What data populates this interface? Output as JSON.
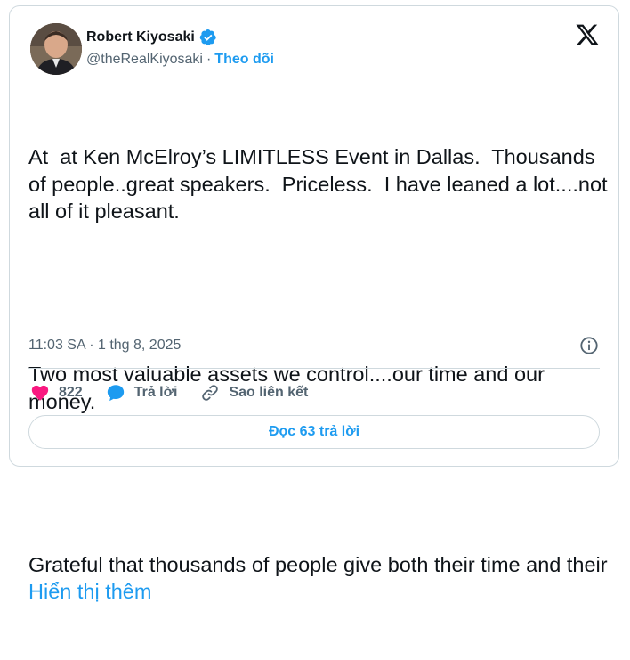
{
  "author": {
    "name": "Robert Kiyosaki",
    "handle": "@theRealKiyosaki",
    "separator": "·",
    "follow_label": "Theo dõi"
  },
  "tweet": {
    "paragraphs": [
      "At  at Ken McElroy’s LIMITLESS Event in Dallas.  Thousands of people..great speakers.  Priceless.  I have leaned a lot....not all of it pleasant.",
      "Two most valuable assets we control....our time and our money.",
      "Grateful that thousands of people give both their time and their "
    ],
    "show_more_label": "Hiển thị thêm",
    "timestamp": "11:03 SA · 1 thg 8, 2025"
  },
  "actions": {
    "like_count": "822",
    "reply_label": "Trả lời",
    "copy_link_label": "Sao liên kết"
  },
  "replies_button_label": "Đọc 63 trả lời",
  "colors": {
    "accent": "#1d9bf0",
    "like": "#f91880",
    "text": "#0f1419",
    "secondary_text": "#536471",
    "border": "#cfd9de"
  },
  "icons": [
    "verified-badge-icon",
    "x-logo-icon",
    "info-icon",
    "heart-icon",
    "reply-bubble-icon",
    "link-icon"
  ]
}
